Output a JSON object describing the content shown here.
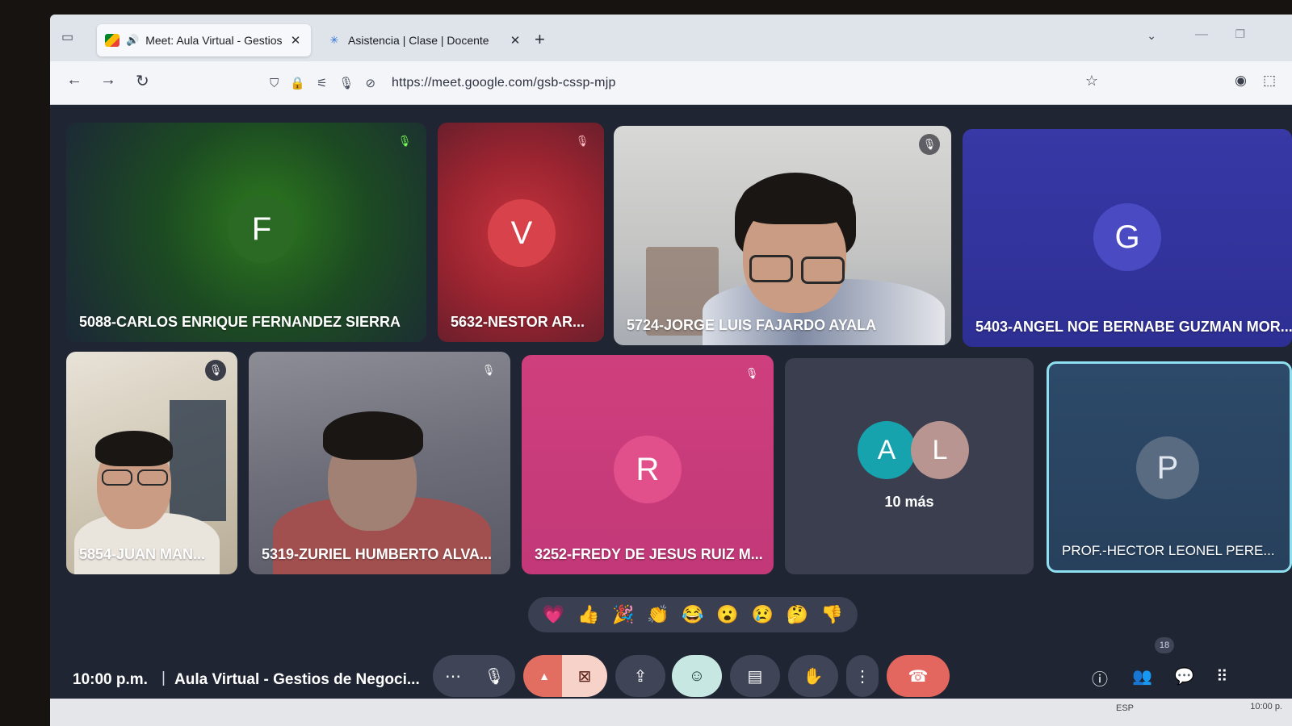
{
  "browser": {
    "tabs": [
      {
        "title": "Meet: Aula Virtual - Gestios",
        "active": true
      },
      {
        "title": "Asistencia | Clase | Docente",
        "active": false
      }
    ],
    "url": "https://meet.google.com/gsb-cssp-mjp"
  },
  "participants": [
    {
      "initial": "F",
      "name": "5088-CARLOS ENRIQUE FERNANDEZ SIERRA"
    },
    {
      "initial": "V",
      "name": "5632-NESTOR AR..."
    },
    {
      "initial": "",
      "name": "5724-JORGE LUIS FAJARDO AYALA"
    },
    {
      "initial": "G",
      "name": "5403-ANGEL NOE BERNABE GUZMAN MOR..."
    },
    {
      "initial": "",
      "name": "5854-JUAN MAN..."
    },
    {
      "initial": "",
      "name": "5319-ZURIEL HUMBERTO ALVA..."
    },
    {
      "initial": "R",
      "name": "3252-FREDY DE JESUS RUIZ M..."
    },
    {
      "initial": "P",
      "name": "PROF.-HECTOR LEONEL PERE..."
    }
  ],
  "more_tile": {
    "initials": [
      "A",
      "L"
    ],
    "label": "10 más"
  },
  "reactions": [
    "💗",
    "👍",
    "🎉",
    "👏",
    "😂",
    "😮",
    "😢",
    "🤔",
    "👎"
  ],
  "meeting": {
    "time": "10:00 p.m.",
    "separator": "|",
    "title": "Aula Virtual - Gestios de Negoci..."
  },
  "people_count": "18",
  "taskbar": {
    "lang": "ESP",
    "time": "10:00 p."
  }
}
